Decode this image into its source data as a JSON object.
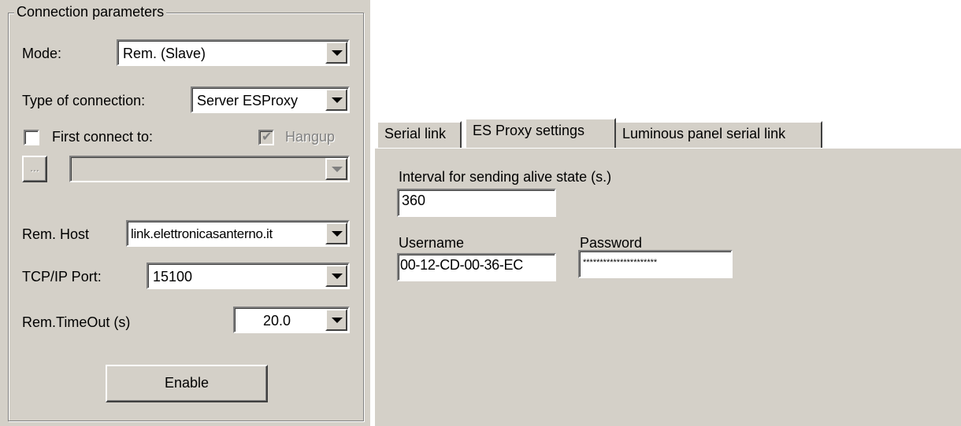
{
  "connection": {
    "group_title": "Connection parameters",
    "mode_label": "Mode:",
    "mode_value": "Rem. (Slave)",
    "type_label": "Type of connection:",
    "type_value": "Server ESProxy",
    "first_connect_label": "First connect to:",
    "first_connect_checked": false,
    "hangup_label": "Hangup",
    "hangup_checked": true,
    "browse_label": "...",
    "first_connect_value": "",
    "host_label": "Rem. Host",
    "host_value": "link.elettronicasanterno.it",
    "port_label": "TCP/IP Port:",
    "port_value": "15100",
    "timeout_label": "Rem.TimeOut (s)",
    "timeout_value": "20.0",
    "enable_label": "Enable"
  },
  "tabs": [
    {
      "label": "Serial link",
      "active": false
    },
    {
      "label": "ES Proxy settings",
      "active": true
    },
    {
      "label": "Luminous panel serial link",
      "active": false
    }
  ],
  "proxy": {
    "interval_label": "Interval for sending alive state (s.)",
    "interval_value": "360",
    "username_label": "Username",
    "username_value": "00-12-CD-00-36-EC",
    "password_label": "Password",
    "password_value": "**********************"
  },
  "colors": {
    "face": "#d4d0c8",
    "shadow": "#808080",
    "highlight": "#ffffff"
  }
}
